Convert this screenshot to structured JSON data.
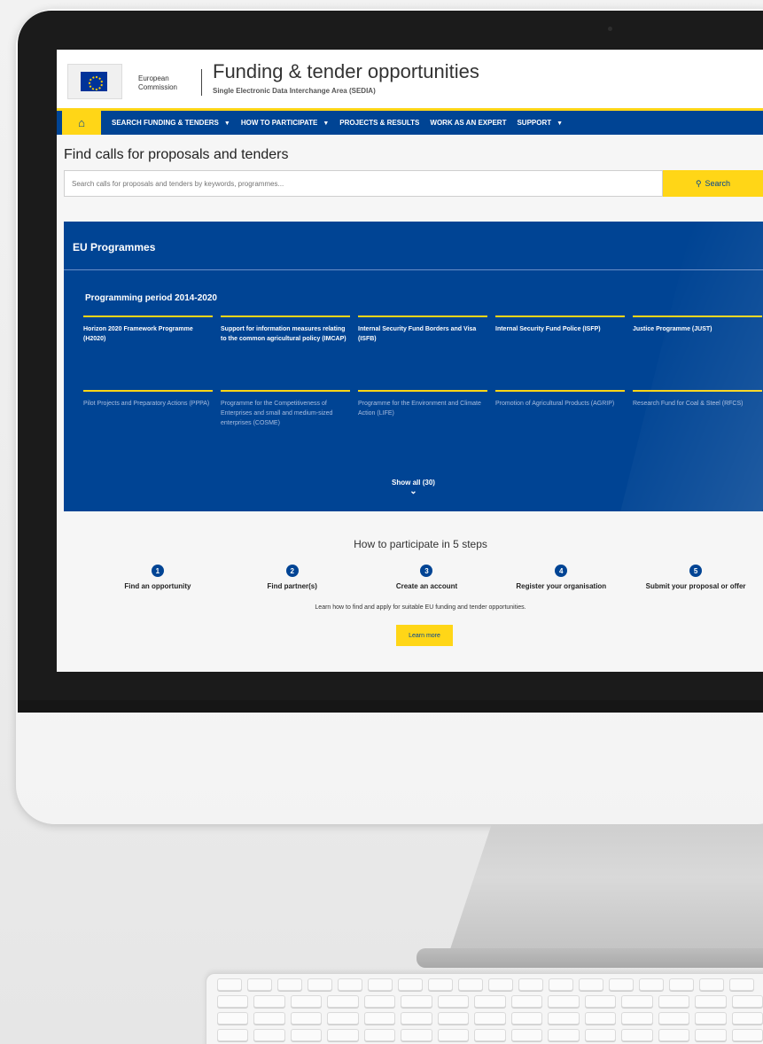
{
  "header": {
    "ec_name_line1": "European",
    "ec_name_line2": "Commission",
    "site_title": "Funding & tender opportunities",
    "site_subtitle": "Single Electronic Data Interchange Area (SEDIA)"
  },
  "nav": {
    "home_icon": "home-icon",
    "items": [
      {
        "label": "SEARCH FUNDING & TENDERS",
        "has_caret": true
      },
      {
        "label": "HOW TO PARTICIPATE",
        "has_caret": true
      },
      {
        "label": "PROJECTS & RESULTS",
        "has_caret": false
      },
      {
        "label": "WORK AS AN EXPERT",
        "has_caret": false
      },
      {
        "label": "SUPPORT",
        "has_caret": true
      }
    ]
  },
  "search": {
    "heading": "Find calls for proposals and tenders",
    "placeholder": "Search calls for proposals and tenders by keywords, programmes...",
    "button_label": "Search"
  },
  "programmes": {
    "title": "EU Programmes",
    "period": "Programming period 2014-2020",
    "items": [
      "Horizon 2020 Framework Programme (H2020)",
      "Support for information measures relating to the common agricultural policy (IMCAP)",
      "Internal Security Fund Borders and Visa (ISFB)",
      "Internal Security Fund Police (ISFP)",
      "Justice Programme (JUST)",
      "Pilot Projects and Preparatory Actions (PPPA)",
      "Programme for the Competitiveness of Enterprises and small and medium-sized enterprises (COSME)",
      "Programme for the Environment and Climate Action (LIFE)",
      "Promotion of Agricultural Products (AGRIP)",
      "Research Fund for Coal & Steel (RFCS)"
    ],
    "show_all": "Show all (30)"
  },
  "steps": {
    "title": "How to participate in 5 steps",
    "items": [
      {
        "num": "1",
        "label": "Find an opportunity"
      },
      {
        "num": "2",
        "label": "Find partner(s)"
      },
      {
        "num": "3",
        "label": "Create an account"
      },
      {
        "num": "4",
        "label": "Register your organisation"
      },
      {
        "num": "5",
        "label": "Submit your proposal or offer"
      }
    ],
    "learn_text": "Learn how to find and apply for suitable EU funding and tender opportunities.",
    "learn_button": "Learn more"
  },
  "colors": {
    "brand_blue": "#004494",
    "accent_yellow": "#ffd617"
  }
}
